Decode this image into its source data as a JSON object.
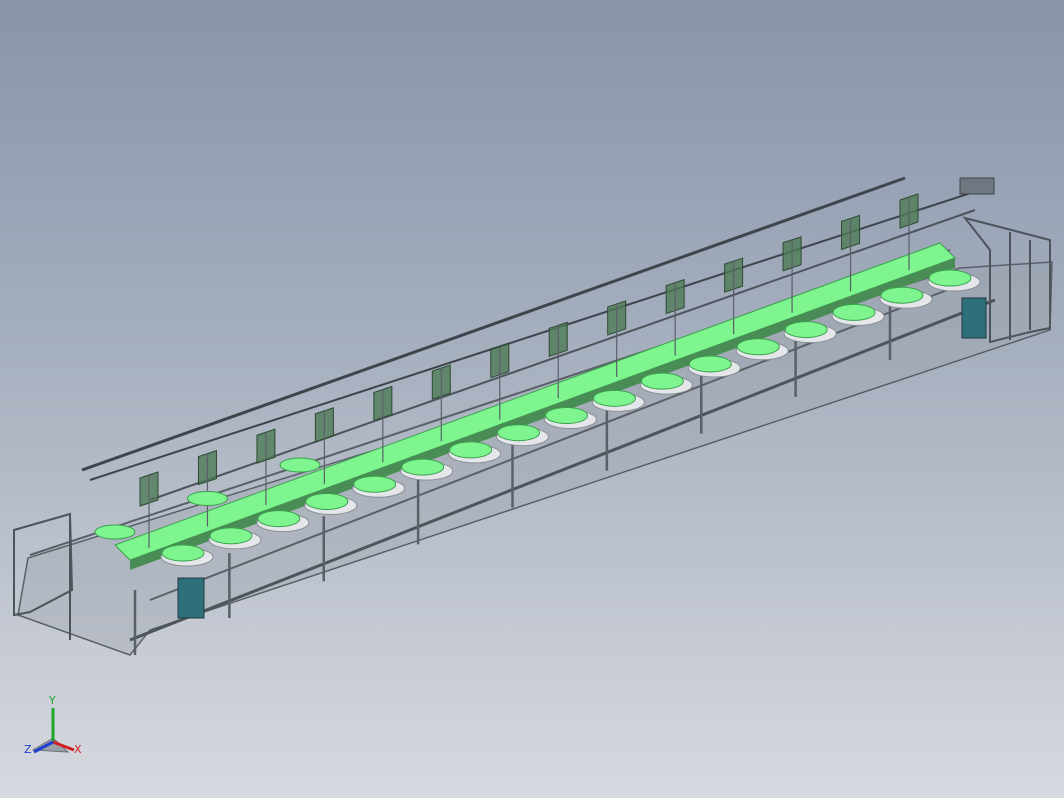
{
  "viewport": {
    "background_top": "#8794aa",
    "background_bottom": "#d6d9df"
  },
  "model": {
    "pad_count": 17,
    "colors": {
      "frame": "#5a6068",
      "frame_light": "#a8adb4",
      "belt": "#7ef58f",
      "belt_edge": "#3aa04c",
      "panel": "#4d7a56",
      "cabinet": "#2f6f7a",
      "tray": "#e4e6ea"
    }
  },
  "triad": {
    "x_label": "X",
    "y_label": "Y",
    "z_label": "Z",
    "x_color": "#d21f1f",
    "y_color": "#1fa62a",
    "z_color": "#1f3fd2"
  }
}
